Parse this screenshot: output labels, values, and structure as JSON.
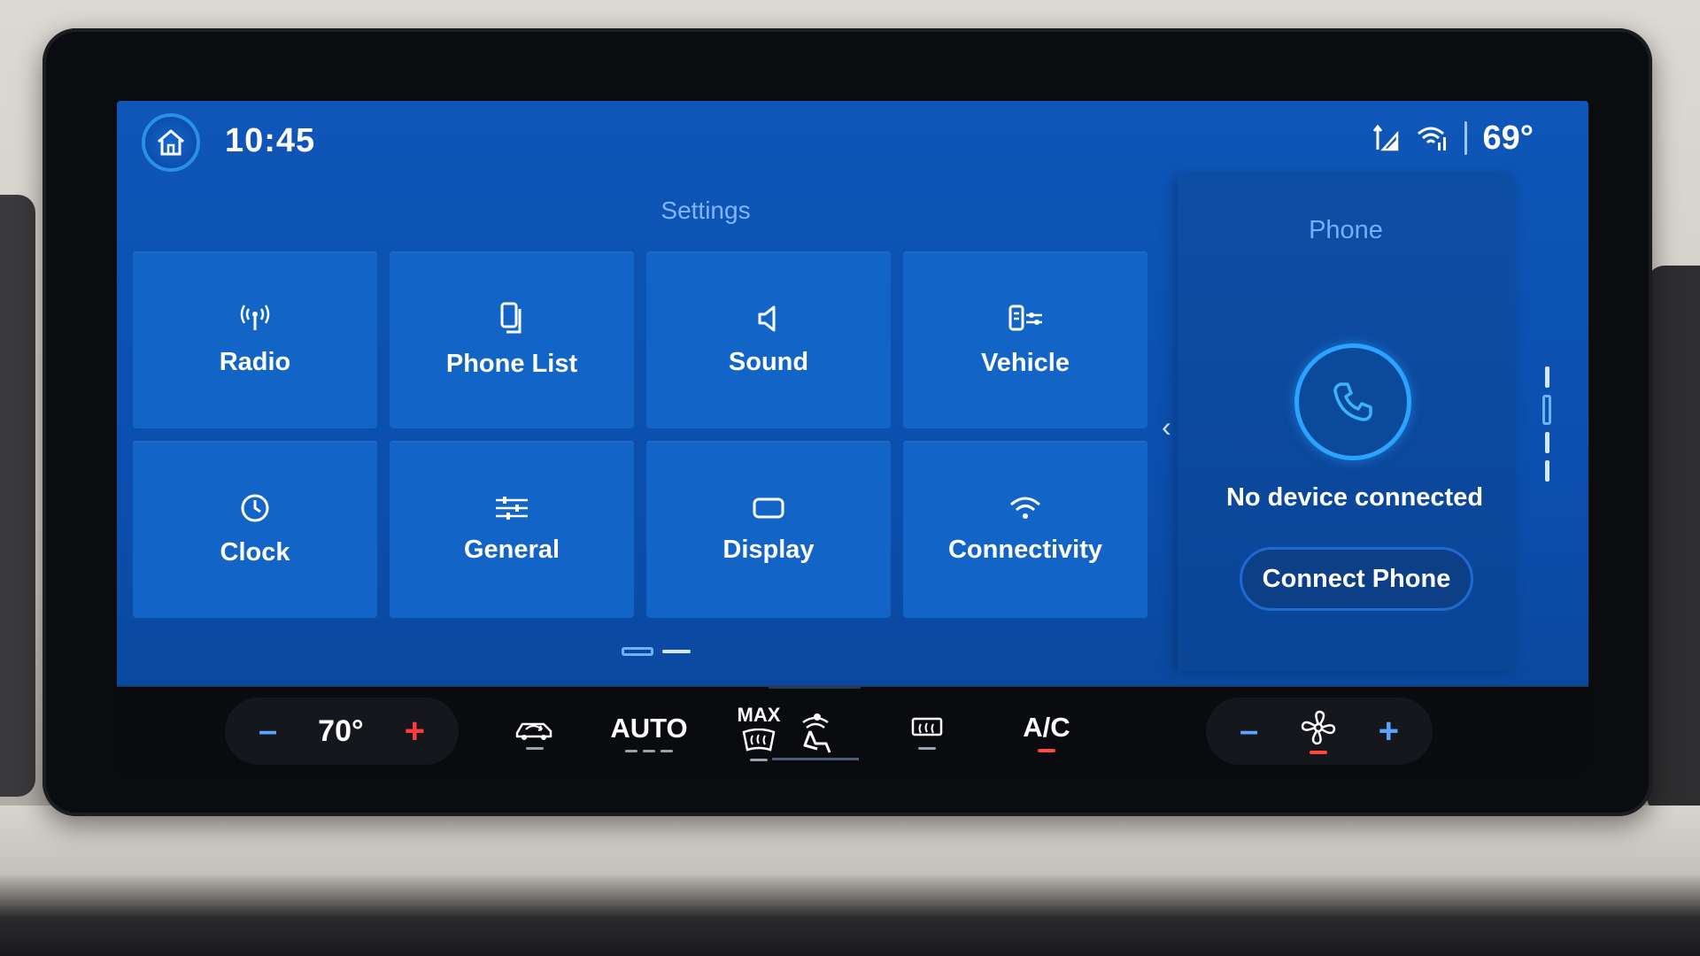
{
  "status_bar": {
    "time": "10:45",
    "outside_temp": "69°",
    "icons": [
      "home-icon",
      "navigation-signal-icon",
      "wifi-icon"
    ]
  },
  "settings": {
    "title": "Settings",
    "tiles": [
      {
        "label": "Radio",
        "icon": "radio-antenna-icon"
      },
      {
        "label": "Phone List",
        "icon": "phone-list-icon"
      },
      {
        "label": "Sound",
        "icon": "speaker-icon"
      },
      {
        "label": "Vehicle",
        "icon": "vehicle-settings-icon"
      },
      {
        "label": "Clock",
        "icon": "clock-icon"
      },
      {
        "label": "General",
        "icon": "sliders-icon"
      },
      {
        "label": "Display",
        "icon": "display-icon"
      },
      {
        "label": "Connectivity",
        "icon": "wifi-icon"
      }
    ],
    "pagination": {
      "pages": 2,
      "current": 1
    }
  },
  "phone": {
    "title": "Phone",
    "status": "No device connected",
    "connect_label": "Connect Phone"
  },
  "climate": {
    "driver_temp": "70°",
    "minus_label": "–",
    "plus_label": "+",
    "auto_label": "AUTO",
    "max_label": "MAX",
    "ac_label": "A/C",
    "fan_minus_label": "–",
    "fan_plus_label": "+"
  },
  "colors": {
    "screen_bg": "#0b4fae",
    "tile_bg": "#1364c7",
    "accent": "#6fb0ff",
    "climate_bg": "#0a0b0f",
    "indicator_red": "#ff4a3a"
  }
}
